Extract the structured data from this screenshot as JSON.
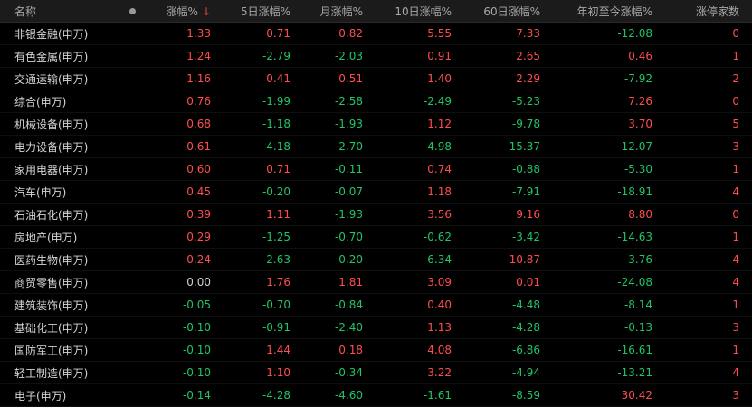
{
  "colors": {
    "up": "#ff4d4f",
    "down": "#21c467",
    "flat": "#cfcfcf",
    "selected": "#46c3d6"
  },
  "header": {
    "name": "名称",
    "c1": "涨幅%",
    "c2": "5日涨幅%",
    "c3": "月涨幅%",
    "c4": "10日涨幅%",
    "c5": "60日涨幅%",
    "c6": "年初至今涨幅%",
    "c7": "涨停家数",
    "sort_icon": "sort-desc-arrow-icon"
  },
  "rows": [
    {
      "name": "非银金融(申万)",
      "v": [
        "1.33",
        "0.71",
        "0.82",
        "5.55",
        "7.33",
        "-12.08",
        "0"
      ]
    },
    {
      "name": "有色金属(申万)",
      "v": [
        "1.24",
        "-2.79",
        "-2.03",
        "0.91",
        "2.65",
        "0.46",
        "1"
      ]
    },
    {
      "name": "交通运输(申万)",
      "v": [
        "1.16",
        "0.41",
        "0.51",
        "1.40",
        "2.29",
        "-7.92",
        "2"
      ]
    },
    {
      "name": "综合(申万)",
      "v": [
        "0.76",
        "-1.99",
        "-2.58",
        "-2.49",
        "-5.23",
        "7.26",
        "0"
      ]
    },
    {
      "name": "机械设备(申万)",
      "v": [
        "0.68",
        "-1.18",
        "-1.93",
        "1.12",
        "-9.78",
        "3.70",
        "5"
      ]
    },
    {
      "name": "电力设备(申万)",
      "v": [
        "0.61",
        "-4.18",
        "-2.70",
        "-4.98",
        "-15.37",
        "-12.07",
        "3"
      ]
    },
    {
      "name": "家用电器(申万)",
      "v": [
        "0.60",
        "0.71",
        "-0.11",
        "0.74",
        "-0.88",
        "-5.30",
        "1"
      ]
    },
    {
      "name": "汽车(申万)",
      "v": [
        "0.45",
        "-0.20",
        "-0.07",
        "1.18",
        "-7.91",
        "-18.91",
        "4"
      ]
    },
    {
      "name": "石油石化(申万)",
      "v": [
        "0.39",
        "1.11",
        "-1.93",
        "3.56",
        "9.16",
        "8.80",
        "0"
      ]
    },
    {
      "name": "房地产(申万)",
      "v": [
        "0.29",
        "-1.25",
        "-0.70",
        "-0.62",
        "-3.42",
        "-14.63",
        "1"
      ]
    },
    {
      "name": "医药生物(申万)",
      "v": [
        "0.24",
        "-2.63",
        "-0.20",
        "-6.34",
        "10.87",
        "-3.76",
        "4"
      ]
    },
    {
      "name": "商贸零售(申万)",
      "v": [
        "0.00",
        "1.76",
        "1.81",
        "3.09",
        "0.01",
        "-24.08",
        "4"
      ]
    },
    {
      "name": "建筑装饰(申万)",
      "v": [
        "-0.05",
        "-0.70",
        "-0.84",
        "0.40",
        "-4.48",
        "-8.14",
        "1"
      ]
    },
    {
      "name": "基础化工(申万)",
      "v": [
        "-0.10",
        "-0.91",
        "-2.40",
        "1.13",
        "-4.28",
        "-0.13",
        "3"
      ]
    },
    {
      "name": "国防军工(申万)",
      "v": [
        "-0.10",
        "1.44",
        "0.18",
        "4.08",
        "-6.86",
        "-16.61",
        "1"
      ]
    },
    {
      "name": "轻工制造(申万)",
      "v": [
        "-0.10",
        "1.10",
        "-0.34",
        "3.22",
        "-4.94",
        "-13.21",
        "4"
      ]
    },
    {
      "name": "电子(申万)",
      "v": [
        "-0.14",
        "-4.28",
        "-4.60",
        "-1.61",
        "-8.59",
        "30.42",
        "3"
      ]
    }
  ],
  "selected_row": 1
}
